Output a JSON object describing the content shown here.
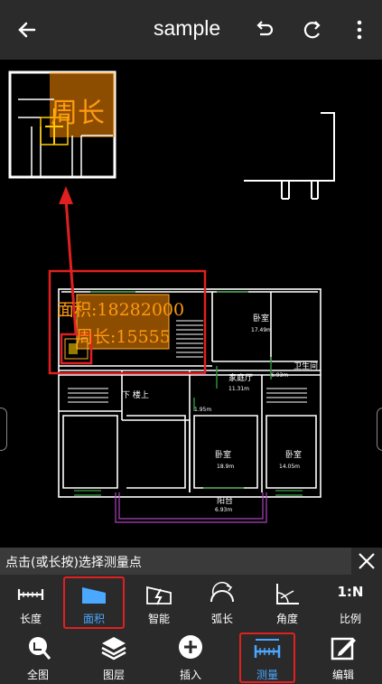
{
  "header": {
    "title": "sample",
    "back_icon": "arrow-left-icon",
    "undo_icon": "undo-icon",
    "redo_icon": "redo-icon",
    "menu_icon": "more-vertical-icon"
  },
  "drawing": {
    "area_text": "面积:18282000",
    "perimeter_text": "周长:15555",
    "magnifier_text": "周长",
    "rooms": {
      "bedroom_top": "卧室",
      "bedroom_top_area": "17.49m",
      "living": "家庭厅",
      "living_area": "11.31m",
      "bathroom": "卫生间",
      "bathroom_area": "6.93m",
      "stairs_label": "下 楼上",
      "small_area": "1.95m",
      "bedroom_left": "卧室",
      "bedroom_left_area": "18.9m",
      "bedroom_right": "卧室",
      "bedroom_right_area": "14.05m",
      "balcony": "阳台",
      "balcony_area": "6.93m"
    },
    "accent_color": "#ff8c00",
    "annotation_color": "#e02020"
  },
  "hint": {
    "text": "点击(或长按)选择测量点",
    "close_icon": "close-icon"
  },
  "measure_tools": [
    {
      "label": "长度",
      "icon": "ruler-length-icon"
    },
    {
      "label": "面积",
      "icon": "area-icon",
      "selected": true
    },
    {
      "label": "智能",
      "icon": "smart-measure-icon"
    },
    {
      "label": "弧长",
      "icon": "arc-length-icon"
    },
    {
      "label": "角度",
      "icon": "angle-icon"
    },
    {
      "label": "比例",
      "icon": "scale-ratio-icon",
      "icon_text": "1:N"
    }
  ],
  "nav": [
    {
      "label": "全图",
      "icon": "zoom-fit-icon"
    },
    {
      "label": "图层",
      "icon": "layers-icon"
    },
    {
      "label": "插入",
      "icon": "add-icon"
    },
    {
      "label": "测量",
      "icon": "measure-icon",
      "selected": true
    },
    {
      "label": "编辑",
      "icon": "edit-icon"
    }
  ]
}
